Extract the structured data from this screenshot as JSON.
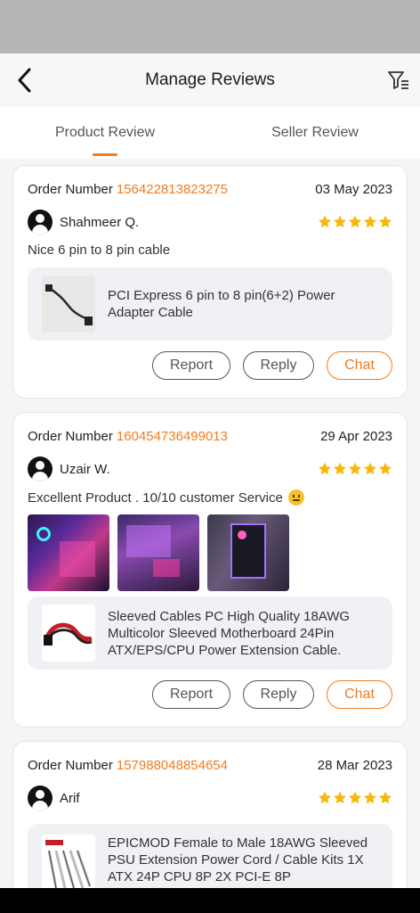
{
  "header": {
    "title": "Manage Reviews",
    "back_icon": "chevron-left-icon",
    "filter_icon": "filter-icon"
  },
  "tabs": [
    {
      "label": "Product Review",
      "active": true
    },
    {
      "label": "Seller Review",
      "active": false
    }
  ],
  "colors": {
    "accent": "#f07c1f",
    "star": "#f6b80f",
    "background": "#f5f5f7"
  },
  "reviews": [
    {
      "order_label": "Order Number",
      "order_number": "156422813823275",
      "date": "03 May 2023",
      "user": "Shahmeer Q.",
      "rating": 5,
      "comment": "Nice 6 pin to 8 pin cable",
      "photos": 0,
      "product": "PCI Express 6 pin to 8 pin(6+2) Power Adapter Cable",
      "buttons": {
        "report": "Report",
        "reply": "Reply",
        "chat": "Chat"
      }
    },
    {
      "order_label": "Order Number",
      "order_number": "160454736499013",
      "date": "29 Apr 2023",
      "user": "Uzair W.",
      "rating": 5,
      "comment": "Excellent Product . 10/10 customer Service",
      "photos": 3,
      "product": "Sleeved Cables PC High Quality 18AWG Multicolor Sleeved Motherboard 24Pin ATX/EPS/CPU Power Extension Cable.",
      "buttons": {
        "report": "Report",
        "reply": "Reply",
        "chat": "Chat"
      }
    },
    {
      "order_label": "Order Number",
      "order_number": "157988048854654",
      "date": "28 Mar 2023",
      "user": "Arif",
      "rating": 5,
      "product": "EPICMOD Female to Male 18AWG Sleeved PSU Extension Power Cord / Cable Kits 1X ATX 24P CPU 8P 2X PCI-E 8P"
    }
  ]
}
